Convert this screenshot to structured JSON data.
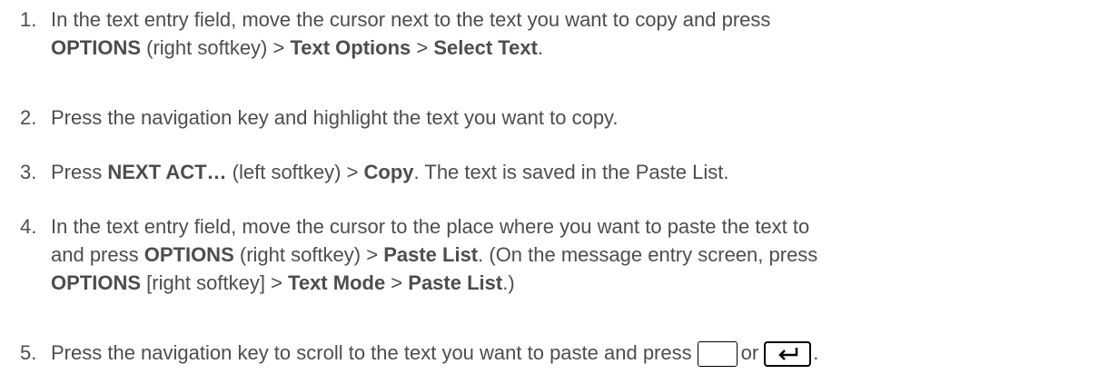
{
  "steps": [
    {
      "number": "1.",
      "parts": [
        "In the text entry field, move the cursor next to the text you want to copy and press",
        "OPTIONS",
        " (right softkey) > ",
        "Text Options",
        " > ",
        "Select Text",
        "."
      ]
    },
    {
      "number": "2.",
      "parts": [
        "Press the navigation key and highlight the text you want to copy."
      ]
    },
    {
      "number": "3.",
      "parts": [
        "Press ",
        "NEXT ACT…",
        " (left softkey) > ",
        "Copy",
        ". The text is saved in the Paste List."
      ]
    },
    {
      "number": "4.",
      "parts": [
        "In the text entry field, move the cursor to the place where you want to paste the text to",
        "and press ",
        "OPTIONS",
        " (right softkey) > ",
        "Paste List",
        ". (On the message entry screen, press",
        "OPTIONS",
        " [right softkey] > ",
        "Text Mode",
        " > ",
        "Paste List",
        ".)"
      ]
    },
    {
      "number": "5.",
      "parts": [
        "Press the navigation key to scroll to the text you want to paste and press",
        "or",
        "."
      ]
    }
  ],
  "icons": {
    "blank_key": "blank-softkey-icon",
    "enter_key": "enter-key-icon"
  }
}
